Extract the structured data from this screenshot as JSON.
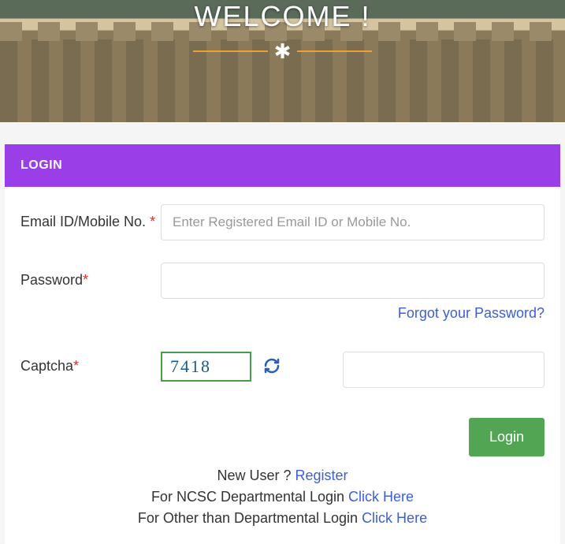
{
  "banner": {
    "welcome": "WELCOME !"
  },
  "login": {
    "header": "LOGIN",
    "email_label": "Email ID/Mobile No. ",
    "email_placeholder": "Enter Registered Email ID or Mobile No.",
    "password_label": "Password",
    "forgot_link": "Forgot your Password?",
    "captcha_label": "Captcha",
    "captcha_value": "7418",
    "login_button": "Login"
  },
  "links": {
    "new_user_prefix": "New User ? ",
    "new_user_link": "Register",
    "ncsc_prefix": "For NCSC Departmental Login ",
    "ncsc_link": "Click Here",
    "other_prefix": "For Other than Departmental Login ",
    "other_link": "Click Here"
  }
}
